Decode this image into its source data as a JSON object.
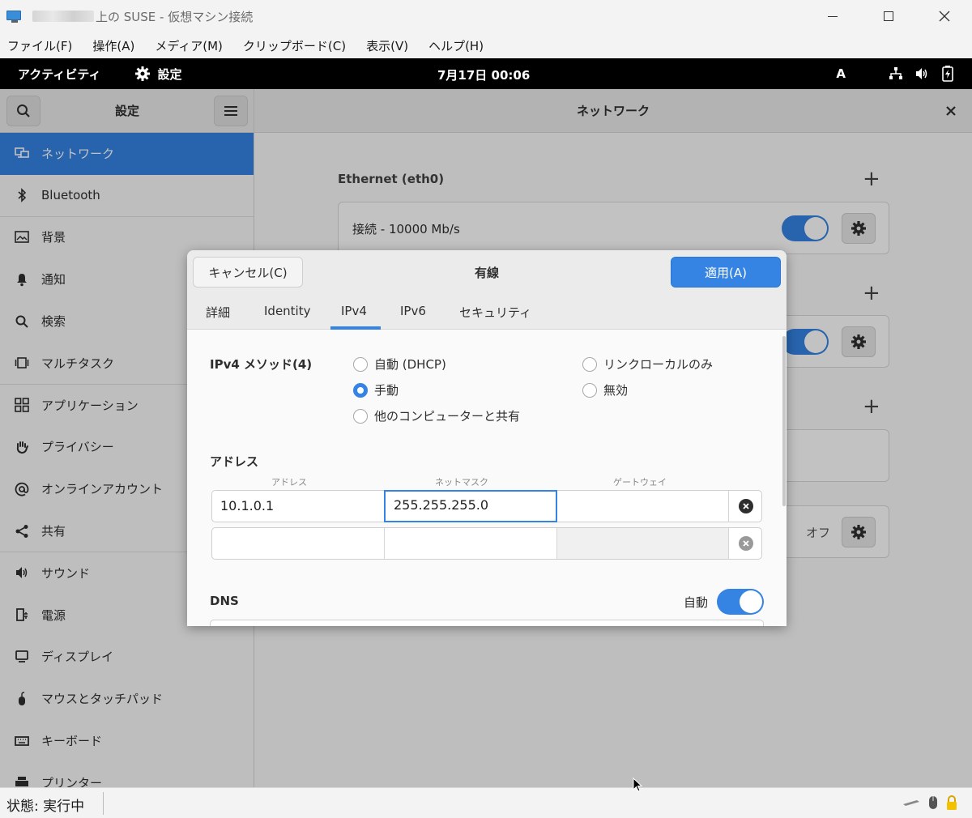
{
  "host": {
    "title": "上の SUSE - 仮想マシン接続",
    "menu": [
      "ファイル(F)",
      "操作(A)",
      "メディア(M)",
      "クリップボード(C)",
      "表示(V)",
      "ヘルプ(H)"
    ],
    "status": "状態: 実行中"
  },
  "gnome": {
    "activities": "アクティビティ",
    "app_name": "設定",
    "clock": "7月17日  00:06",
    "ime": "A"
  },
  "settings": {
    "sidebar_title": "設定",
    "page_title": "ネットワーク",
    "sidebar_items": [
      {
        "label": "ネットワーク",
        "icon": "network-icon"
      },
      {
        "label": "Bluetooth",
        "icon": "bluetooth-icon"
      },
      {
        "label": "背景",
        "icon": "background-icon"
      },
      {
        "label": "通知",
        "icon": "bell-icon"
      },
      {
        "label": "検索",
        "icon": "search-icon"
      },
      {
        "label": "マルチタスク",
        "icon": "multitask-icon"
      },
      {
        "label": "アプリケーション",
        "icon": "apps-icon"
      },
      {
        "label": "プライバシー",
        "icon": "hand-icon"
      },
      {
        "label": "オンラインアカウント",
        "icon": "at-icon"
      },
      {
        "label": "共有",
        "icon": "share-icon"
      },
      {
        "label": "サウンド",
        "icon": "speaker-icon"
      },
      {
        "label": "電源",
        "icon": "power-icon"
      },
      {
        "label": "ディスプレイ",
        "icon": "display-icon"
      },
      {
        "label": "マウスとタッチパッド",
        "icon": "mouse-icon"
      },
      {
        "label": "キーボード",
        "icon": "keyboard-icon"
      },
      {
        "label": "プリンター",
        "icon": "printer-icon"
      }
    ],
    "ethernet_title": "Ethernet (eth0)",
    "ethernet_status": "接続 - 10000 Mb/s",
    "proxy_status": "オフ"
  },
  "dialog": {
    "cancel": "キャンセル(C)",
    "title": "有線",
    "apply": "適用(A)",
    "tabs": [
      "詳細",
      "Identity",
      "IPv4",
      "IPv6",
      "セキュリティ"
    ],
    "active_tab": "IPv4",
    "method_label": "IPv4 メソッド(4)",
    "methods": {
      "dhcp": "自動 (DHCP)",
      "link_local": "リンクローカルのみ",
      "manual": "手動",
      "disabled": "無効",
      "shared": "他のコンピューターと共有"
    },
    "selected_method": "手動",
    "address_section": "アドレス",
    "columns": [
      "アドレス",
      "ネットマスク",
      "ゲートウェイ"
    ],
    "rows": [
      {
        "address": "10.1.0.1",
        "netmask": "255.255.255.0",
        "gateway": ""
      },
      {
        "address": "",
        "netmask": "",
        "gateway": ""
      }
    ],
    "dns_label": "DNS",
    "dns_auto": "自動",
    "dns_auto_on": true
  },
  "colors": {
    "accent": "#3584e4",
    "topbar": "#000000",
    "sidebar_selected": "#3584e4"
  }
}
